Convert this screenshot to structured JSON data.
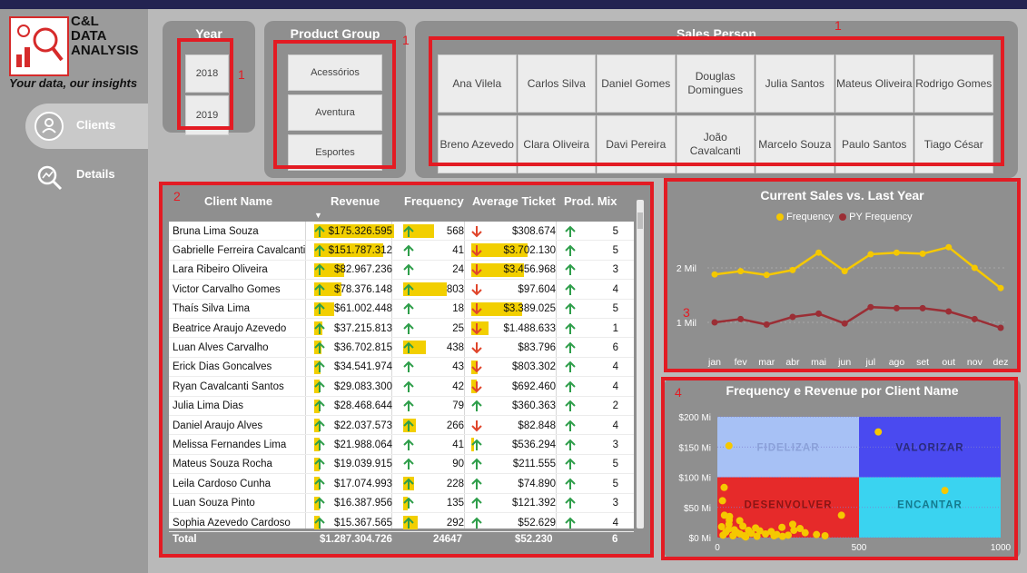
{
  "logo": {
    "line1": "C&L",
    "line2": "DATA",
    "line3": "ANALYSIS",
    "tagline": "Your data, our insights"
  },
  "nav": {
    "clients": "Clients",
    "details": "Details"
  },
  "year_slicer": {
    "title": "Year",
    "items": [
      "2018",
      "2019"
    ]
  },
  "product_slicer": {
    "title": "Product Group",
    "items": [
      "Acessórios",
      "Aventura",
      "Esportes"
    ]
  },
  "sales_slicer": {
    "title": "Sales Person",
    "row1": [
      "Ana Vilela",
      "Carlos Silva",
      "Daniel Gomes",
      "Douglas Domingues",
      "Julia Santos",
      "Mateus Oliveira",
      "Rodrigo Gomes"
    ],
    "row2": [
      "Breno Azevedo",
      "Clara Oliveira",
      "Davi Pereira",
      "João Cavalcanti",
      "Marcelo Souza",
      "Paulo Santos",
      "Tiago César"
    ]
  },
  "annotations": {
    "a1": "1",
    "a2": "2",
    "a3": "3",
    "a4": "4"
  },
  "table": {
    "headers": {
      "client": "Client Name",
      "revenue": "Revenue",
      "frequency": "Frequency",
      "ticket": "Average Ticket",
      "mix": "Prod. Mix"
    },
    "rows": [
      {
        "name": "Bruna Lima Souza",
        "revenue": "$175.326.595",
        "rev_frac": 1.0,
        "frequency": "568",
        "freq_frac": 0.7,
        "ticket": "$308.674",
        "ticket_up": false,
        "ticket_frac": 0,
        "mix": "5"
      },
      {
        "name": "Gabrielle Ferreira Cavalcanti",
        "revenue": "$151.787.312",
        "rev_frac": 0.86,
        "frequency": "41",
        "freq_frac": 0,
        "ticket": "$3.702.130",
        "ticket_up": false,
        "ticket_frac": 1.0,
        "mix": "5"
      },
      {
        "name": "Lara Ribeiro Oliveira",
        "revenue": "$82.967.236",
        "rev_frac": 0.38,
        "frequency": "24",
        "freq_frac": 0,
        "ticket": "$3.456.968",
        "ticket_up": false,
        "ticket_frac": 0.93,
        "mix": "3"
      },
      {
        "name": "Victor Carvalho Gomes",
        "revenue": "$78.376.148",
        "rev_frac": 0.34,
        "frequency": "803",
        "freq_frac": 1.0,
        "ticket": "$97.604",
        "ticket_up": false,
        "ticket_frac": 0,
        "mix": "4"
      },
      {
        "name": "Thaís Silva Lima",
        "revenue": "$61.002.448",
        "rev_frac": 0.25,
        "frequency": "18",
        "freq_frac": 0,
        "ticket": "$3.389.025",
        "ticket_up": false,
        "ticket_frac": 0.91,
        "mix": "5"
      },
      {
        "name": "Beatrice Araujo Azevedo",
        "revenue": "$37.215.813",
        "rev_frac": 0.1,
        "frequency": "25",
        "freq_frac": 0,
        "ticket": "$1.488.633",
        "ticket_up": false,
        "ticket_frac": 0.3,
        "mix": "1"
      },
      {
        "name": "Luan Alves Carvalho",
        "revenue": "$36.702.815",
        "rev_frac": 0.09,
        "frequency": "438",
        "freq_frac": 0.53,
        "ticket": "$83.796",
        "ticket_up": false,
        "ticket_frac": 0,
        "mix": "6"
      },
      {
        "name": "Erick Dias Goncalves",
        "revenue": "$34.541.974",
        "rev_frac": 0.08,
        "frequency": "43",
        "freq_frac": 0,
        "ticket": "$803.302",
        "ticket_up": false,
        "ticket_frac": 0.12,
        "mix": "4"
      },
      {
        "name": "Ryan Cavalcanti Santos",
        "revenue": "$29.083.300",
        "rev_frac": 0.05,
        "frequency": "42",
        "freq_frac": 0,
        "ticket": "$692.460",
        "ticket_up": false,
        "ticket_frac": 0.09,
        "mix": "4"
      },
      {
        "name": "Julia Lima Dias",
        "revenue": "$28.468.644",
        "rev_frac": 0.05,
        "frequency": "79",
        "freq_frac": 0,
        "ticket": "$360.363",
        "ticket_up": true,
        "ticket_frac": 0,
        "mix": "2"
      },
      {
        "name": "Daniel Araujo Alves",
        "revenue": "$22.037.573",
        "rev_frac": 0.02,
        "frequency": "266",
        "freq_frac": 0.29,
        "ticket": "$82.848",
        "ticket_up": false,
        "ticket_frac": 0,
        "mix": "4"
      },
      {
        "name": "Melissa Fernandes Lima",
        "revenue": "$21.988.064",
        "rev_frac": 0.02,
        "frequency": "41",
        "freq_frac": 0,
        "ticket": "$536.294",
        "ticket_up": true,
        "ticket_frac": 0.05,
        "mix": "3"
      },
      {
        "name": "Mateus Souza Rocha",
        "revenue": "$19.039.915",
        "rev_frac": 0.0,
        "frequency": "90",
        "freq_frac": 0,
        "ticket": "$211.555",
        "ticket_up": true,
        "ticket_frac": 0,
        "mix": "5"
      },
      {
        "name": "Leila Cardoso Cunha",
        "revenue": "$17.074.993",
        "rev_frac": 0.0,
        "frequency": "228",
        "freq_frac": 0.24,
        "ticket": "$74.890",
        "ticket_up": true,
        "ticket_frac": 0,
        "mix": "5"
      },
      {
        "name": "Luan Souza Pinto",
        "revenue": "$16.387.956",
        "rev_frac": 0.0,
        "frequency": "135",
        "freq_frac": 0.1,
        "ticket": "$121.392",
        "ticket_up": true,
        "ticket_frac": 0,
        "mix": "3"
      },
      {
        "name": "Sophia Azevedo Cardoso",
        "revenue": "$15.367.565",
        "rev_frac": 0.0,
        "frequency": "292",
        "freq_frac": 0.33,
        "ticket": "$52.629",
        "ticket_up": true,
        "ticket_frac": 0,
        "mix": "4"
      }
    ],
    "total": {
      "label": "Total",
      "revenue": "$1.287.304.726",
      "frequency": "24647",
      "ticket": "$52.230",
      "mix": "6"
    }
  },
  "chart_data": [
    {
      "type": "line",
      "title": "Current Sales vs. Last Year",
      "categories": [
        "jan",
        "fev",
        "mar",
        "abr",
        "mai",
        "jun",
        "jul",
        "ago",
        "set",
        "out",
        "nov",
        "dez"
      ],
      "series": [
        {
          "name": "Frequency",
          "values": [
            1.88,
            1.94,
            1.87,
            1.96,
            2.28,
            1.94,
            2.25,
            2.28,
            2.26,
            2.38,
            2.0,
            1.63
          ]
        },
        {
          "name": "PY Frequency",
          "values": [
            1.0,
            1.06,
            0.96,
            1.1,
            1.16,
            0.98,
            1.28,
            1.26,
            1.26,
            1.2,
            1.06,
            0.9
          ]
        }
      ],
      "yticks": [
        "2 Mil",
        "1 Mil"
      ],
      "ylim": [
        0.6,
        2.6
      ],
      "colors": {
        "Frequency": "#f5c800",
        "PY Frequency": "#9b2e35"
      }
    },
    {
      "type": "scatter",
      "title": "Frequency e Revenue por Client Name",
      "xticks": [
        "0",
        "500",
        "1000"
      ],
      "yticks": [
        "$200 Mi",
        "$150 Mi",
        "$100 Mi",
        "$50 Mi",
        "$0 Mi"
      ],
      "xlim": [
        0,
        1000
      ],
      "ylim": [
        0,
        200
      ],
      "quadrants": {
        "top_left": "FIDELIZAR",
        "top_right": "VALORIZAR",
        "bottom_left": "DESENVOLVER",
        "bottom_right": "ENCANTAR"
      },
      "quadrant_colors": {
        "top_left": "#a7c1f5",
        "top_right": "#4a4af0",
        "bottom_left": "#e62a2a",
        "bottom_right": "#3ad3f0"
      },
      "points": [
        {
          "x": 568,
          "y": 175
        },
        {
          "x": 41,
          "y": 152
        },
        {
          "x": 803,
          "y": 78
        },
        {
          "x": 24,
          "y": 83
        },
        {
          "x": 18,
          "y": 61
        },
        {
          "x": 25,
          "y": 37
        },
        {
          "x": 438,
          "y": 37
        },
        {
          "x": 43,
          "y": 35
        },
        {
          "x": 42,
          "y": 29
        },
        {
          "x": 79,
          "y": 28
        },
        {
          "x": 266,
          "y": 22
        },
        {
          "x": 41,
          "y": 22
        },
        {
          "x": 90,
          "y": 19
        },
        {
          "x": 228,
          "y": 17
        },
        {
          "x": 135,
          "y": 16
        },
        {
          "x": 292,
          "y": 15
        },
        {
          "x": 60,
          "y": 13
        },
        {
          "x": 110,
          "y": 12
        },
        {
          "x": 150,
          "y": 11
        },
        {
          "x": 190,
          "y": 10
        },
        {
          "x": 30,
          "y": 9
        },
        {
          "x": 70,
          "y": 8
        },
        {
          "x": 120,
          "y": 7
        },
        {
          "x": 170,
          "y": 6
        },
        {
          "x": 210,
          "y": 5
        },
        {
          "x": 250,
          "y": 4
        },
        {
          "x": 20,
          "y": 4
        },
        {
          "x": 55,
          "y": 3
        },
        {
          "x": 95,
          "y": 3
        },
        {
          "x": 140,
          "y": 2
        },
        {
          "x": 310,
          "y": 8
        },
        {
          "x": 350,
          "y": 5
        },
        {
          "x": 380,
          "y": 3
        },
        {
          "x": 270,
          "y": 12
        },
        {
          "x": 40,
          "y": 14
        },
        {
          "x": 80,
          "y": 6
        },
        {
          "x": 15,
          "y": 18
        },
        {
          "x": 200,
          "y": 3
        },
        {
          "x": 230,
          "y": 2
        },
        {
          "x": 100,
          "y": 1
        }
      ],
      "point_color": "#f5c800"
    }
  ]
}
